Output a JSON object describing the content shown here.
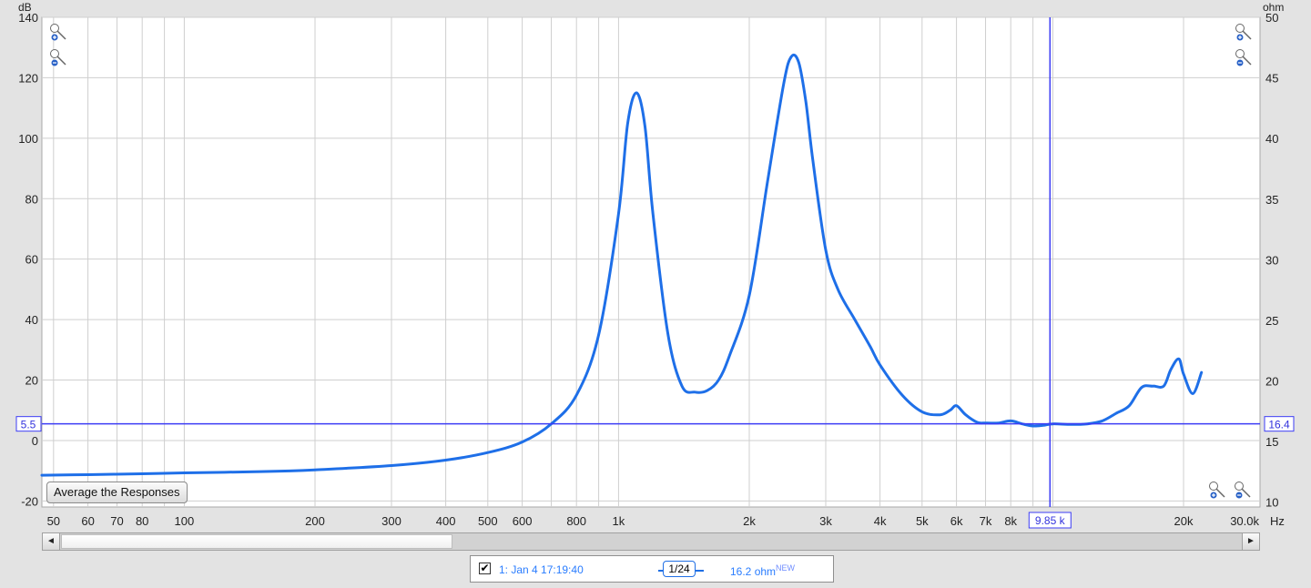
{
  "chart_data": {
    "type": "line",
    "title": "",
    "xlabel": "Hz",
    "ylabel": "dB",
    "y2label": "ohm",
    "xscale": "log",
    "xlim": [
      47,
      30000
    ],
    "ylim": [
      -22,
      140
    ],
    "y2lim": [
      9.6,
      50
    ],
    "grid": true,
    "x_ticks": [
      "50",
      "60",
      "70",
      "80",
      "100",
      "200",
      "300",
      "400",
      "500",
      "600",
      "800",
      "1k",
      "2k",
      "3k",
      "4k",
      "5k",
      "6k",
      "7k",
      "8k",
      "20k",
      "30.0k"
    ],
    "y_ticks": [
      "140",
      "120",
      "100",
      "80",
      "60",
      "40",
      "20",
      "0",
      "-20"
    ],
    "y2_ticks": [
      "50",
      "45",
      "40",
      "35",
      "30",
      "25",
      "20",
      "15",
      "10"
    ],
    "series": [
      {
        "color": "#1e6fe8",
        "x": [
          47,
          60,
          80,
          100,
          150,
          200,
          300,
          400,
          500,
          600,
          700,
          800,
          900,
          1000,
          1050,
          1100,
          1150,
          1200,
          1300,
          1400,
          1500,
          1600,
          1700,
          1800,
          2000,
          2200,
          2400,
          2500,
          2600,
          2700,
          2800,
          3000,
          3200,
          3500,
          3800,
          4000,
          4500,
          5000,
          5500,
          5800,
          6000,
          6300,
          6700,
          7000,
          7500,
          8000,
          8500,
          9000,
          9500,
          10000,
          11000,
          12000,
          13000,
          14000,
          15000,
          16000,
          17000,
          18000,
          18700,
          19500,
          20000,
          21000,
          22000
        ],
        "y": [
          -11.5,
          -11.3,
          -11.0,
          -10.7,
          -10.3,
          -9.7,
          -8.3,
          -6.5,
          -4.0,
          -0.5,
          5.5,
          15,
          35,
          75,
          105,
          115,
          104,
          75,
          35,
          18,
          16,
          16.5,
          20,
          28,
          48,
          85,
          118,
          127,
          125,
          112,
          93,
          63,
          50,
          40,
          31,
          25,
          15,
          9.5,
          8.5,
          10,
          11.5,
          8.5,
          6.0,
          5.8,
          5.8,
          6.5,
          5.5,
          4.8,
          5.0,
          5.5,
          5.3,
          5.5,
          6.5,
          9.0,
          11.5,
          17.5,
          18.0,
          18.0,
          23.5,
          27,
          22,
          15.5,
          22.5
        ]
      }
    ],
    "cursor": {
      "x": 9850,
      "x_label": "9.85 k",
      "y_left_label": "5.5",
      "y_right_label": "16.4"
    }
  },
  "labels": {
    "y_left_unit": "dB",
    "y_right_unit": "ohm",
    "x_unit": "Hz",
    "average_button": "Average the Responses"
  },
  "scrollbar": {
    "left_arrow": "◄",
    "right_arrow": "►"
  },
  "legend": {
    "check": "✔",
    "name": "1: Jan 4 17:19:40",
    "smoothing": "1/24",
    "value": "16.2 ohm",
    "badge": "NEW"
  },
  "colors": {
    "trace": "#1e6fe8",
    "cursor": "#3c3cf5",
    "plot_background": "#ffffff",
    "grid": "#cfcfcf"
  }
}
